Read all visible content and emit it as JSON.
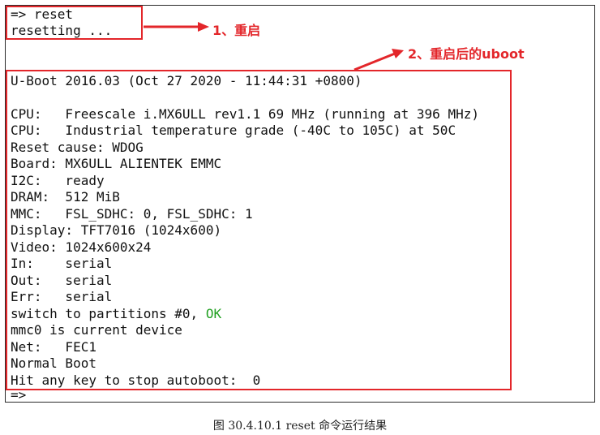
{
  "terminal": {
    "lines": [
      "=> reset",
      "resetting ...",
      "",
      "",
      "U-Boot 2016.03 (Oct 27 2020 - 11:44:31 +0800)",
      "",
      "CPU:   Freescale i.MX6ULL rev1.1 69 MHz (running at 396 MHz)",
      "CPU:   Industrial temperature grade (-40C to 105C) at 50C",
      "Reset cause: WDOG",
      "Board: MX6ULL ALIENTEK EMMC",
      "I2C:   ready",
      "DRAM:  512 MiB",
      "MMC:   FSL_SDHC: 0, FSL_SDHC: 1",
      "Display: TFT7016 (1024x600)",
      "Video: 1024x600x24",
      "In:    serial",
      "Out:   serial",
      "Err:   serial",
      "switch to partitions #0, ",
      "mmc0 is current device",
      "Net:   FEC1",
      "Normal Boot",
      "Hit any key to stop autoboot:  0",
      "=>"
    ],
    "ok_word": "OK"
  },
  "annotations": {
    "label_1": "1、重启",
    "label_2": "2、重启后的uboot",
    "color": "#e3262a"
  },
  "caption": "图 30.4.10.1 reset 命令运行结果",
  "colors": {
    "ok": "#22a022",
    "text": "#111111",
    "border": "#2b2b2b"
  }
}
